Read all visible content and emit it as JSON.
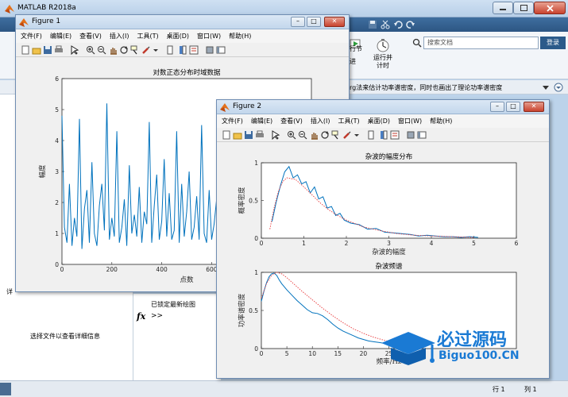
{
  "app": {
    "title": "MATLAB R2018a",
    "search_placeholder": "搜索文档",
    "login_label": "登录",
    "ribbon_labels": [
      "行节",
      "进",
      "运行并\n计时"
    ],
    "path_hint": "rg法来估计功率谱密度，同时也画出了理论功率谱密度",
    "details_hint": "选择文件以查看详细信息",
    "command_text": "已锁定最新绘图",
    "prompt": ">>",
    "fx_label": "fx",
    "status_row_label": "行",
    "status_row_value": "1",
    "status_col_label": "列",
    "status_col_value": "1",
    "left_strip_char": "详"
  },
  "menu_labels": [
    "文件(F)",
    "编辑(E)",
    "查看(V)",
    "插入(I)",
    "工具(T)",
    "桌面(D)",
    "窗口(W)",
    "帮助(H)"
  ],
  "figure1": {
    "title": "Figure 1",
    "chart_title": "对数正态分布时域数据",
    "xlabel": "点数",
    "ylabel": "幅度"
  },
  "figure2": {
    "title": "Figure 2",
    "top_title": "杂波的幅度分布",
    "top_xlabel": "杂波的幅度",
    "top_ylabel": "概率密度",
    "bottom_title": "杂波频谱",
    "bottom_xlabel": "频率/Hz",
    "bottom_ylabel": "功率谱密度"
  },
  "watermark": {
    "brand": "必过源码",
    "site": "Biguo100.CN"
  },
  "colors": {
    "series": "#0072bd",
    "theory": "#e8393b"
  },
  "chart_data": [
    {
      "type": "line",
      "title": "对数正态分布时域数据",
      "xlabel": "点数",
      "ylabel": "幅度",
      "xlim": [
        0,
        1000
      ],
      "ylim": [
        0,
        6
      ],
      "x_ticks": [
        0,
        200,
        400,
        600
      ],
      "y_ticks": [
        0,
        1,
        2,
        3,
        4,
        5,
        6
      ],
      "series": [
        {
          "x": [
            0,
            10,
            20,
            30,
            40,
            50,
            60,
            70,
            80,
            90,
            100,
            110,
            120,
            130,
            140,
            150,
            160,
            170,
            180,
            190,
            200,
            210,
            220,
            230,
            240,
            250,
            260,
            270,
            280,
            290,
            300,
            310,
            320,
            330,
            340,
            350,
            360,
            370,
            380,
            390,
            400,
            410,
            420,
            430,
            440,
            450,
            460,
            470,
            480,
            490,
            500,
            510,
            520,
            530,
            540,
            550,
            560,
            570,
            580,
            590,
            600,
            610,
            620,
            630,
            640,
            650,
            660,
            670,
            680,
            690,
            700,
            710,
            720
          ],
          "values": [
            4.8,
            1.2,
            0.7,
            2.6,
            0.6,
            1.5,
            0.9,
            4.7,
            0.5,
            1.8,
            2.4,
            0.7,
            3.3,
            1.0,
            0.6,
            1.9,
            2.6,
            1.1,
            5.2,
            0.8,
            1.5,
            0.9,
            4.3,
            0.7,
            1.2,
            2.1,
            0.6,
            3.2,
            1.0,
            1.6,
            0.9,
            2.5,
            0.7,
            1.7,
            1.3,
            4.6,
            0.7,
            1.9,
            2.9,
            0.8,
            1.4,
            3.4,
            0.9,
            2.3,
            0.8,
            1.1,
            4.3,
            0.7,
            2.6,
            0.9,
            1.7,
            3.0,
            0.8,
            1.2,
            2.2,
            0.8,
            4.5,
            1.0,
            0.7,
            2.4,
            0.8,
            1.3,
            2.1,
            0.9,
            3.4,
            1.0,
            0.7,
            2.0,
            0.8,
            1.3,
            3.6,
            0.8,
            1.7
          ]
        }
      ]
    },
    {
      "type": "line",
      "title": "杂波的幅度分布",
      "xlabel": "杂波的幅度",
      "ylabel": "概率密度",
      "xlim": [
        0,
        6
      ],
      "ylim": [
        0,
        1
      ],
      "x_ticks": [
        0,
        1,
        2,
        3,
        4,
        5,
        6
      ],
      "y_ticks": [
        0,
        0.5,
        1
      ],
      "series": [
        {
          "style": "solid",
          "x": [
            0.25,
            0.35,
            0.45,
            0.55,
            0.65,
            0.75,
            0.85,
            0.95,
            1.05,
            1.15,
            1.25,
            1.35,
            1.45,
            1.55,
            1.65,
            1.75,
            1.85,
            1.95,
            2.1,
            2.3,
            2.5,
            2.7,
            2.9,
            3.1,
            3.3,
            3.5,
            3.7,
            3.9,
            4.1,
            4.3,
            4.5,
            4.7,
            4.9,
            5.1
          ],
          "values": [
            0.22,
            0.48,
            0.7,
            0.88,
            0.95,
            0.8,
            0.84,
            0.72,
            0.75,
            0.6,
            0.68,
            0.52,
            0.55,
            0.4,
            0.42,
            0.3,
            0.33,
            0.24,
            0.2,
            0.18,
            0.12,
            0.13,
            0.08,
            0.07,
            0.06,
            0.05,
            0.03,
            0.04,
            0.03,
            0.02,
            0.02,
            0.01,
            0.02,
            0.01
          ]
        },
        {
          "style": "dotted",
          "x": [
            0.2,
            0.3,
            0.4,
            0.5,
            0.6,
            0.8,
            1.0,
            1.2,
            1.4,
            1.6,
            1.8,
            2.0,
            2.4,
            2.8,
            3.2,
            3.6,
            4.0,
            4.5,
            5.0
          ],
          "values": [
            0.12,
            0.4,
            0.62,
            0.75,
            0.8,
            0.78,
            0.68,
            0.57,
            0.46,
            0.37,
            0.3,
            0.24,
            0.15,
            0.1,
            0.06,
            0.04,
            0.03,
            0.02,
            0.01
          ]
        }
      ]
    },
    {
      "type": "line",
      "title": "杂波频谱",
      "xlabel": "频率/Hz",
      "ylabel": "功率谱密度",
      "xlim": [
        0,
        50
      ],
      "ylim": [
        0,
        1
      ],
      "x_ticks": [
        0,
        5,
        10,
        15,
        20,
        25
      ],
      "y_ticks": [
        0,
        0.5,
        1
      ],
      "series": [
        {
          "style": "solid",
          "x": [
            0,
            0.5,
            1,
            1.5,
            2,
            2.5,
            3,
            3.5,
            4,
            5,
            6,
            7,
            8,
            9,
            10,
            11,
            12,
            13,
            14,
            15,
            16,
            17,
            18,
            19,
            20,
            21,
            22,
            23,
            24,
            25
          ],
          "values": [
            0.62,
            0.75,
            0.86,
            0.94,
            0.98,
            0.99,
            0.96,
            0.9,
            0.85,
            0.77,
            0.7,
            0.63,
            0.57,
            0.51,
            0.47,
            0.46,
            0.43,
            0.38,
            0.32,
            0.27,
            0.23,
            0.2,
            0.17,
            0.14,
            0.12,
            0.1,
            0.09,
            0.08,
            0.07,
            0.07
          ]
        },
        {
          "style": "dotted",
          "x": [
            0,
            1,
            2,
            3,
            4,
            5,
            6,
            7,
            8,
            10,
            12,
            14,
            16,
            18,
            20,
            22,
            24,
            26
          ],
          "values": [
            0.66,
            0.85,
            0.96,
            1.0,
            0.98,
            0.93,
            0.87,
            0.81,
            0.75,
            0.64,
            0.53,
            0.43,
            0.34,
            0.26,
            0.2,
            0.15,
            0.11,
            0.08
          ]
        }
      ]
    }
  ]
}
